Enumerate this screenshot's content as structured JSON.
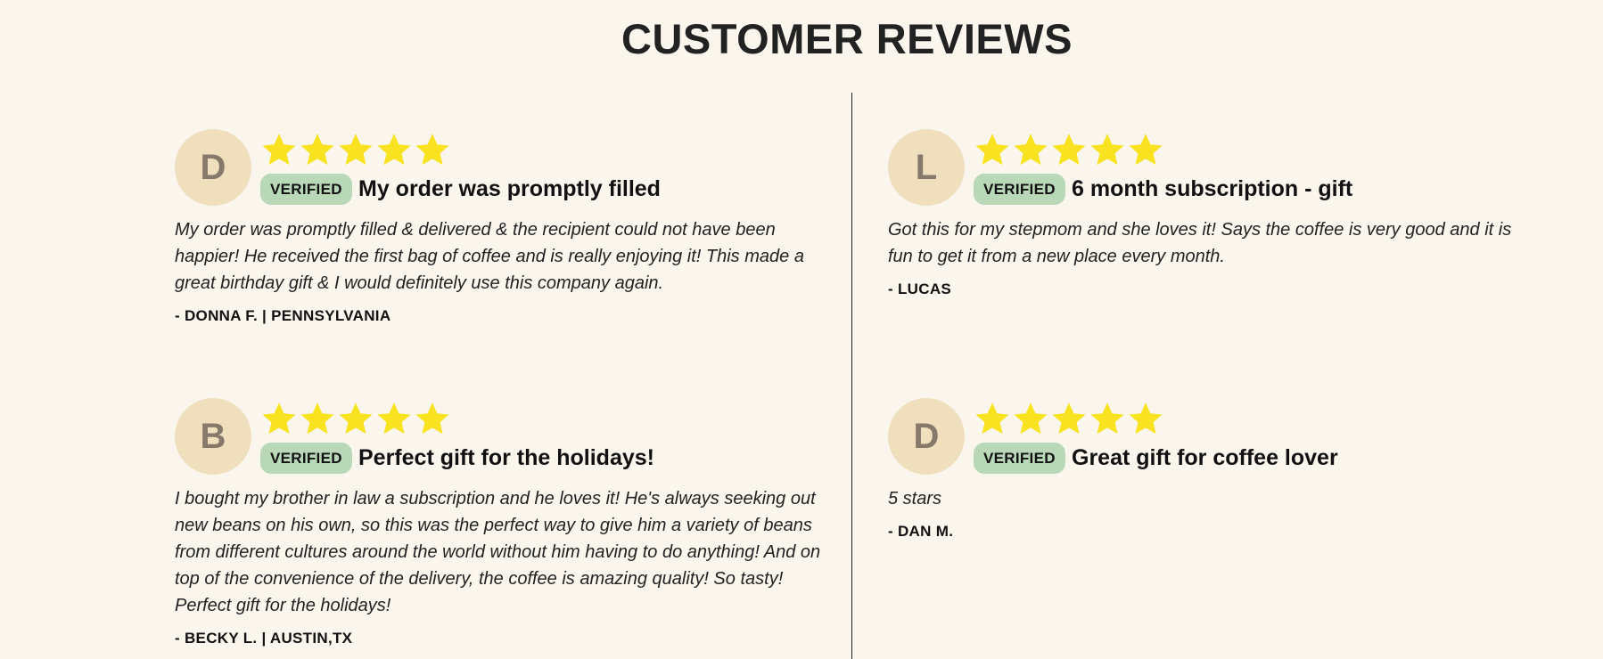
{
  "section": {
    "heading": "CUSTOMER REVIEWS"
  },
  "colors": {
    "background": "#faf6ee",
    "star": "#f9e220",
    "avatar_bg": "#efdfbd",
    "avatar_text": "#86796b",
    "verified_bg": "#b9d8b7"
  },
  "reviews": [
    {
      "initial": "D",
      "rating": 5,
      "badge": "VERIFIED",
      "title": "My order was promptly filled",
      "body": "My order was promptly filled & delivered & the recipient could not have been happier! He received the first bag of coffee and is really enjoying it! This made a great birthday gift & I would definitely use this company again.",
      "author": "- DONNA F. | PENNSYLVANIA"
    },
    {
      "initial": "L",
      "rating": 5,
      "badge": "VERIFIED",
      "title": "6 month subscription - gift",
      "body": "Got this for my stepmom and she loves it! Says the coffee is very good and it is fun to get it from a new place every month.",
      "author": "- LUCAS"
    },
    {
      "initial": "B",
      "rating": 5,
      "badge": "VERIFIED",
      "title": "Perfect gift for the holidays!",
      "body": "I bought my brother in law a subscription and he loves it! He's always seeking out new beans on his own, so this was the perfect way to give him a variety of beans from different cultures around the world without him having to do anything! And on top of the convenience of the delivery, the coffee is amazing quality! So tasty! Perfect gift for the holidays!",
      "author": "- BECKY L. | AUSTIN,TX"
    },
    {
      "initial": "D",
      "rating": 5,
      "badge": "VERIFIED",
      "title": "Great gift for coffee lover",
      "body": "5 stars",
      "author": "- DAN M."
    }
  ]
}
